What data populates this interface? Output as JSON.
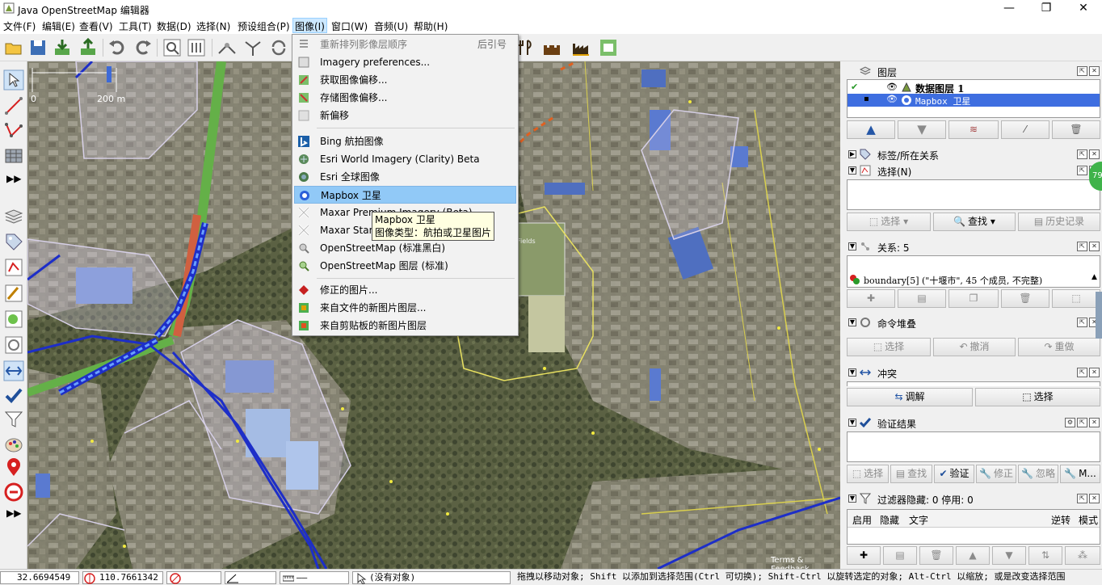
{
  "window": {
    "title": "Java OpenStreetMap 编辑器",
    "minimize": "—",
    "maximize": "❐",
    "close": "✕"
  },
  "menubar": {
    "items": [
      "文件(F)",
      "编辑(E)",
      "查看(V)",
      "工具(T)",
      "数据(D)",
      "选择(N)",
      "预设组合(P)",
      "图像(I)",
      "窗口(W)",
      "音频(U)",
      "帮助(H)"
    ],
    "active_index": 7
  },
  "imagery_menu": {
    "items": [
      {
        "label": "重新排列影像层顺序",
        "shortcut": "后引号",
        "disabled": true,
        "icon": "reorder-icon"
      },
      {
        "label": "Imagery preferences...",
        "icon": "imagery-preferences-icon"
      },
      {
        "label": "获取图像偏移...",
        "icon": "get-offset-icon"
      },
      {
        "label": "存储图像偏移...",
        "icon": "store-offset-icon"
      },
      {
        "label": "新偏移",
        "icon": "new-offset-icon"
      },
      {
        "label": "Bing 航拍图像",
        "icon": "bing-icon"
      },
      {
        "label": "Esri World Imagery (Clarity) Beta",
        "icon": "esri-clarity-icon"
      },
      {
        "label": "Esri 全球图像",
        "icon": "esri-globe-icon"
      },
      {
        "label": "Mapbox 卫星",
        "icon": "mapbox-icon",
        "highlighted": true
      },
      {
        "label": "Maxar Premium Imagery (Beta)",
        "icon": "maxar-icon"
      },
      {
        "label": "Maxar Standard Imagery (Beta)",
        "icon": "maxar-icon"
      },
      {
        "label": "OpenStreetMap (标准黑白)",
        "icon": "osm-bw-icon"
      },
      {
        "label": "OpenStreetMap 图层 (标准)",
        "icon": "osm-standard-icon"
      },
      {
        "label": "修正的图片...",
        "icon": "rectified-icon"
      },
      {
        "label": "来自文件的新图片图层...",
        "icon": "file-image-icon"
      },
      {
        "label": "来自剪贴板的新图片图层",
        "icon": "clipboard-image-icon"
      }
    ]
  },
  "tooltip": {
    "line1": "Mapbox 卫星",
    "line2": "图像类型：航拍或卫星图片"
  },
  "map": {
    "scale_label": "200 m",
    "scale_zero": "0",
    "attribution": "Terms & Feedback",
    "place_label": "Fields"
  },
  "panels": {
    "layers": {
      "title": "图层",
      "rows": [
        {
          "name": "数据图层 1",
          "bold": true
        },
        {
          "name": "Mapbox 卫星",
          "selected": true
        }
      ]
    },
    "tags": {
      "title": "标签/所在关系"
    },
    "selection": {
      "title": "选择(N)",
      "buttons": {
        "select": "选择",
        "search": "查找",
        "history": "历史记录"
      }
    },
    "relations": {
      "title": "关系: 5",
      "item": "boundary[5] (\"十堰市\", 45 个成员, 不完整)"
    },
    "command_stack": {
      "title": "命令堆叠",
      "buttons": {
        "select": "选择",
        "undo": "撤消",
        "redo": "重做"
      }
    },
    "conflicts": {
      "title": "冲突",
      "buttons": {
        "resolve": "调解",
        "select": "选择"
      }
    },
    "validation": {
      "title": "验证结果",
      "buttons": {
        "select": "选择",
        "search": "查找",
        "validate": "验证",
        "fix": "修正",
        "ignore": "忽略",
        "more": "M..."
      }
    },
    "filters": {
      "title": "过滤器隐藏: 0 停用: 0",
      "columns": [
        "启用",
        "隐藏",
        "文字",
        "逆转",
        "模式"
      ]
    },
    "badge": "79"
  },
  "statusbar": {
    "lat": "32.6694549",
    "lon": "110.7661342",
    "angle": "",
    "length": "",
    "scale": "——",
    "object": "(没有对象)",
    "help": "拖拽以移动对象; Shift 以添加到选择范围(Ctrl 可切换); Shift-Ctrl 以旋转选定的对象; Alt-Ctrl 以缩放; 或是改变选择范围"
  },
  "colors": {
    "menu_highlight": "#91c9f7",
    "tooltip_bg": "#ffffe1",
    "selected_layer": "#3e6ee0"
  }
}
